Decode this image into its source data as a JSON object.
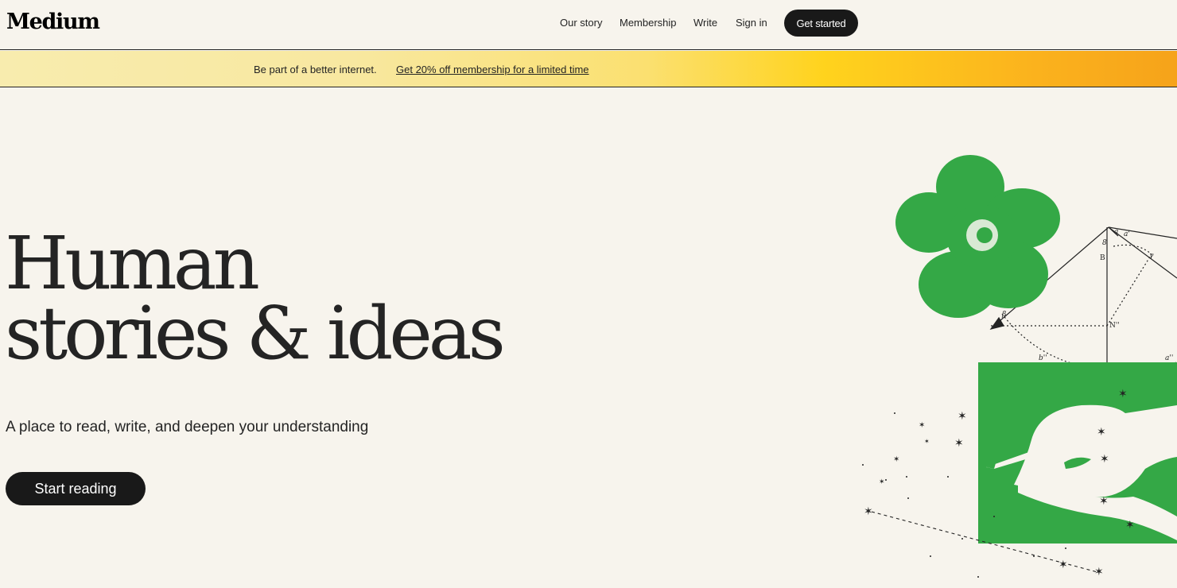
{
  "header": {
    "logo": "Medium",
    "nav": {
      "our_story": "Our story",
      "membership": "Membership",
      "write": "Write",
      "sign_in": "Sign in"
    },
    "cta": "Get started"
  },
  "promo": {
    "text": "Be part of a better internet.",
    "link": "Get 20% off membership for a limited time"
  },
  "hero": {
    "title_line1": "Human",
    "title_line2": "stories & ideas",
    "subtitle": "A place to read, write, and deepen your understanding",
    "button": "Start reading"
  },
  "illustration": {
    "labels": {
      "a_prime": "a'",
      "a_double_prime": "a''",
      "alpha": "a",
      "b_upper": "B",
      "b_double_prime": "b''",
      "b_digit": "8",
      "n_double_prime": "N''",
      "e_upper": "E",
      "gamma": "γ",
      "beta": "β"
    }
  },
  "colors": {
    "background": "#f7f4ed",
    "text": "#242424",
    "button": "#191919",
    "green": "#34a846",
    "banner_start": "#f8ecae",
    "banner_end": "#f6a31a"
  }
}
